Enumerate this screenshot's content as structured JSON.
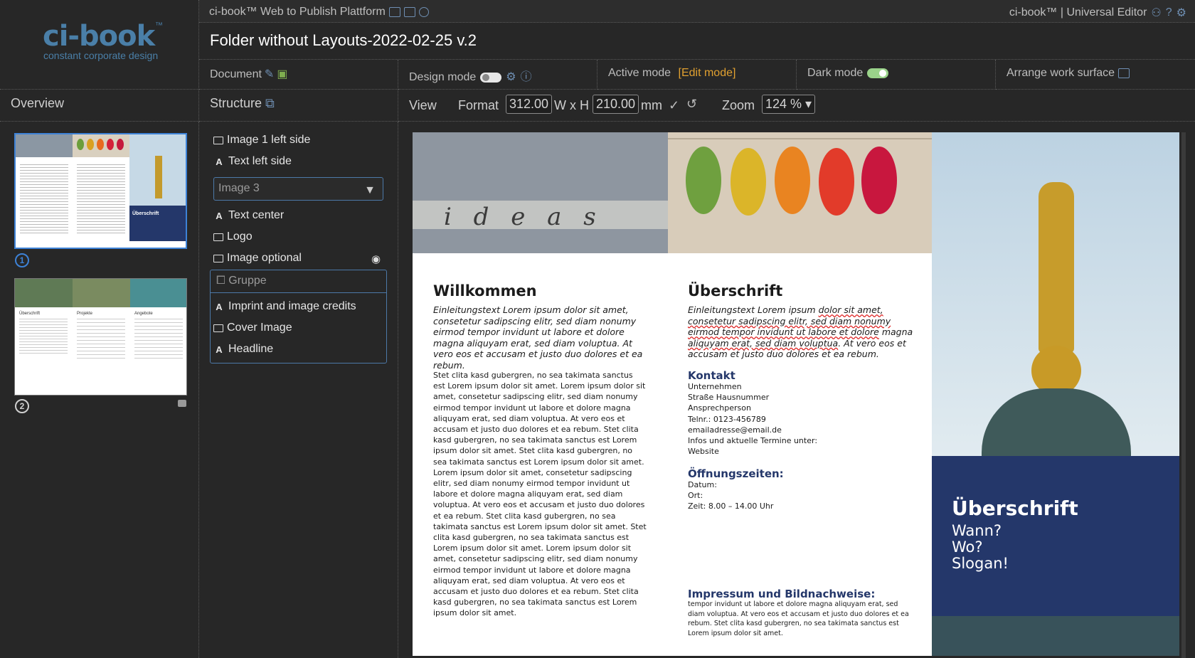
{
  "brand": {
    "name": "ci-book",
    "tm": "™",
    "tagline": "constant corporate design"
  },
  "topbar": {
    "title": "ci-book™ Web to Publish Plattform",
    "right": "ci-book™ | Universal Editor"
  },
  "document_title": "Folder without Layouts-2022-02-25 v.2",
  "toolbar": {
    "document_label": "Document",
    "design_mode_label": "Design mode",
    "active_mode_label": "Active mode",
    "active_mode_value": "[Edit mode]",
    "dark_mode_label": "Dark mode",
    "arrange_label": "Arrange work surface"
  },
  "panels": {
    "overview": "Overview",
    "structure": "Structure",
    "view": "View"
  },
  "view": {
    "format_label": "Format",
    "width": "312.00",
    "wxh": "W x H",
    "height": "210.00",
    "unit": "mm",
    "zoom_label": "Zoom",
    "zoom_value": "124 %"
  },
  "pages": [
    {
      "number": "1"
    },
    {
      "number": "2"
    }
  ],
  "structure": {
    "items": [
      "Image 1 left side",
      "Text left side",
      "Text center",
      "Logo",
      "Image optional"
    ],
    "select_value": "Image 3",
    "group_label": "Gruppe",
    "group_items": [
      "Imprint and image credits",
      "Cover Image",
      "Headline"
    ]
  },
  "doc": {
    "ideas_word": "i d e a s",
    "left": {
      "title": "Willkommen",
      "intro": "Einleitungstext Lorem ipsum dolor sit amet, consetetur sadipscing elitr, sed diam nonumy eirmod tempor invidunt ut labore et dolore magna aliquyam erat, sed diam voluptua. At vero eos et accusam et justo duo dolores et ea rebum.",
      "body": "Stet clita kasd gubergren, no sea takimata sanctus est Lorem ipsum dolor sit amet. Lorem ipsum dolor sit amet, consetetur sadipscing elitr, sed diam nonumy eirmod tempor invidunt ut labore et dolore magna aliquyam erat, sed diam voluptua. At vero eos et accusam et justo duo dolores et ea rebum. Stet clita kasd gubergren, no sea takimata sanctus est Lorem ipsum dolor sit amet. Stet clita kasd gubergren, no sea takimata sanctus est Lorem ipsum dolor sit amet. Lorem ipsum dolor sit amet, consetetur sadipscing elitr, sed diam nonumy eirmod tempor invidunt ut labore et dolore magna aliquyam erat, sed diam voluptua. At vero eos et accusam et justo duo dolores et ea rebum. Stet clita kasd gubergren, no sea takimata sanctus est Lorem ipsum dolor sit amet. Stet clita kasd gubergren, no sea takimata sanctus est Lorem ipsum dolor sit amet. Lorem ipsum dolor sit amet, consetetur sadipscing elitr, sed diam nonumy eirmod tempor invidunt ut labore et dolore magna aliquyam erat, sed diam voluptua. At vero eos et accusam et justo duo dolores et ea rebum. Stet clita kasd gubergren, no sea takimata sanctus est Lorem ipsum dolor sit amet."
    },
    "center": {
      "title": "Überschrift",
      "intro_a": "Einleitungstext Lorem ipsum ",
      "intro_b": "dolor sit amet, consetetur sadipscing elitr, sed diam nonumy eirmod tempor invidunt ut labore et dolore",
      "intro_c": " magna ",
      "intro_d": "aliquyam erat, sed diam voluptua",
      "intro_e": ". At vero eos et accusam et justo duo dolores et ea rebum.",
      "contact_title": "Kontakt",
      "contact_lines": [
        "Unternehmen",
        "Straße Hausnummer",
        "Ansprechperson",
        "Telnr.: 0123-456789",
        "emailadresse@email.de",
        "Infos und aktuelle Termine unter:",
        "Website"
      ],
      "hours_title": "Öffnungszeiten:",
      "hours_lines": [
        "Datum:",
        "Ort:",
        "Zeit: 8.00 – 14.00 Uhr"
      ],
      "imprint_title": "Impressum und Bildnachweise:",
      "imprint_text": "tempor invidunt ut labore et dolore magna aliquyam erat, sed diam voluptua. At vero eos et accusam et justo duo dolores et ea rebum. Stet clita kasd gubergren, no sea takimata sanctus est Lorem ipsum dolor sit amet."
    },
    "right": {
      "title": "Überschrift",
      "lines": [
        "Wann?",
        "Wo?",
        "Slogan!"
      ]
    }
  },
  "thumb2": {
    "cols": [
      "Überschrift",
      "Projekte",
      "Angebote"
    ]
  },
  "colors": {
    "accent": "#24376a",
    "edit_mode": "#e0a030",
    "selection": "#4c79a8"
  }
}
